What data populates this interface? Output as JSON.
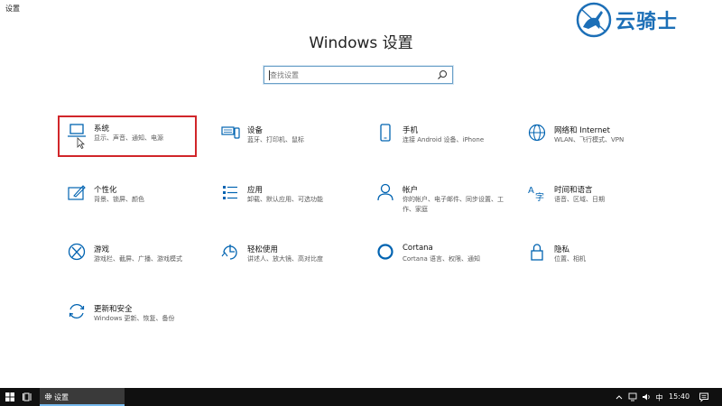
{
  "window": {
    "title": "设置"
  },
  "watermark": {
    "text": "云骑士"
  },
  "header": {
    "title": "Windows 设置"
  },
  "search": {
    "placeholder": "查找设置"
  },
  "tiles": [
    {
      "title": "系统",
      "desc": "显示、声音、通知、电源",
      "icon": "laptop-icon"
    },
    {
      "title": "设备",
      "desc": "蓝牙、打印机、鼠标",
      "icon": "devices-icon"
    },
    {
      "title": "手机",
      "desc": "连接 Android 设备、iPhone",
      "icon": "phone-icon"
    },
    {
      "title": "网络和 Internet",
      "desc": "WLAN、飞行模式、VPN",
      "icon": "globe-icon"
    },
    {
      "title": "个性化",
      "desc": "背景、锁屏、颜色",
      "icon": "personalize-icon"
    },
    {
      "title": "应用",
      "desc": "卸载、默认应用、可选功能",
      "icon": "apps-icon"
    },
    {
      "title": "帐户",
      "desc": "你的帐户、电子邮件、同步设置、工作、家庭",
      "icon": "account-icon"
    },
    {
      "title": "时间和语言",
      "desc": "语音、区域、日期",
      "icon": "language-icon"
    },
    {
      "title": "游戏",
      "desc": "游戏栏、截屏、广播、游戏模式",
      "icon": "xbox-icon"
    },
    {
      "title": "轻松使用",
      "desc": "讲述人、放大镜、高对比度",
      "icon": "ease-of-access-icon"
    },
    {
      "title": "Cortana",
      "desc": "Cortana 语言、权限、通知",
      "icon": "cortana-icon"
    },
    {
      "title": "隐私",
      "desc": "位置、相机",
      "icon": "lock-icon"
    },
    {
      "title": "更新和安全",
      "desc": "Windows 更新、恢复、备份",
      "icon": "update-icon"
    }
  ],
  "taskbar": {
    "app_label": "设置",
    "time": "15:40"
  },
  "colors": {
    "accent": "#0063b1",
    "highlight": "#d1262a",
    "taskbar": "#101010"
  }
}
